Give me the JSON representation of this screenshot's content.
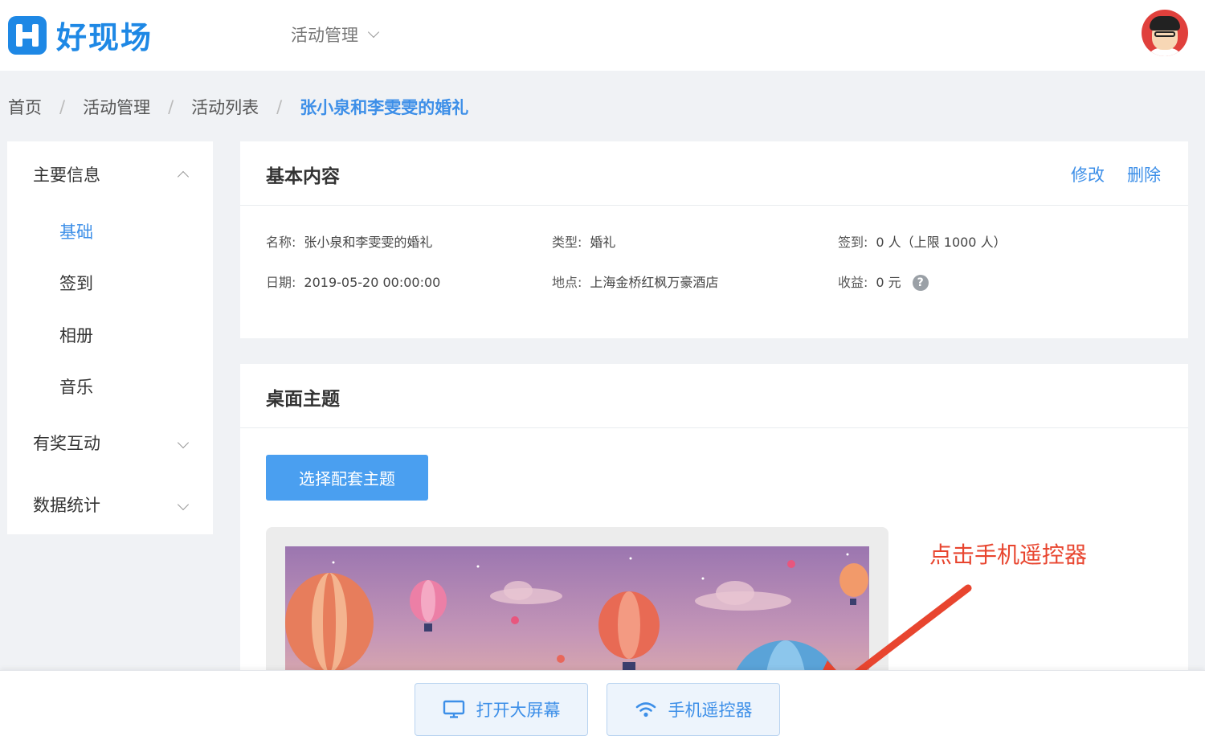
{
  "header": {
    "logo_text": "好现场",
    "nav_label": "活动管理"
  },
  "breadcrumb": [
    {
      "label": "首页"
    },
    {
      "label": "活动管理"
    },
    {
      "label": "活动列表"
    },
    {
      "label": "张小泉和李雯雯的婚礼"
    }
  ],
  "breadcrumb_sep": "/",
  "sidebar": {
    "main_info": "主要信息",
    "sub_items": [
      "基础",
      "签到",
      "相册",
      "音乐"
    ],
    "reward_interaction": "有奖互动",
    "data_stats": "数据统计"
  },
  "basic": {
    "title": "基本内容",
    "edit": "修改",
    "delete": "删除",
    "name_label": "名称:",
    "name_value": "张小泉和李雯雯的婚礼",
    "type_label": "类型:",
    "type_value": "婚礼",
    "checkin_label": "签到:",
    "checkin_value": "0 人（上限 1000 人）",
    "date_label": "日期:",
    "date_value": "2019-05-20 00:00:00",
    "location_label": "地点:",
    "location_value": "上海金桥红枫万豪酒店",
    "revenue_label": "收益:",
    "revenue_value": "0 元",
    "help_glyph": "?"
  },
  "theme": {
    "title": "桌面主题",
    "select_button": "选择配套主题"
  },
  "annotation": "点击手机遥控器",
  "bottom": {
    "open_screen": "打开大屏幕",
    "phone_remote": "手机遥控器"
  },
  "colors": {
    "accent": "#3d8fe8",
    "primary_button": "#4a9ff0",
    "annotation": "#e8452f"
  },
  "icons": [
    "logo-icon",
    "chevron-down-icon",
    "chevron-up-icon",
    "help-icon",
    "monitor-icon",
    "wifi-icon",
    "arrow-annotation"
  ]
}
